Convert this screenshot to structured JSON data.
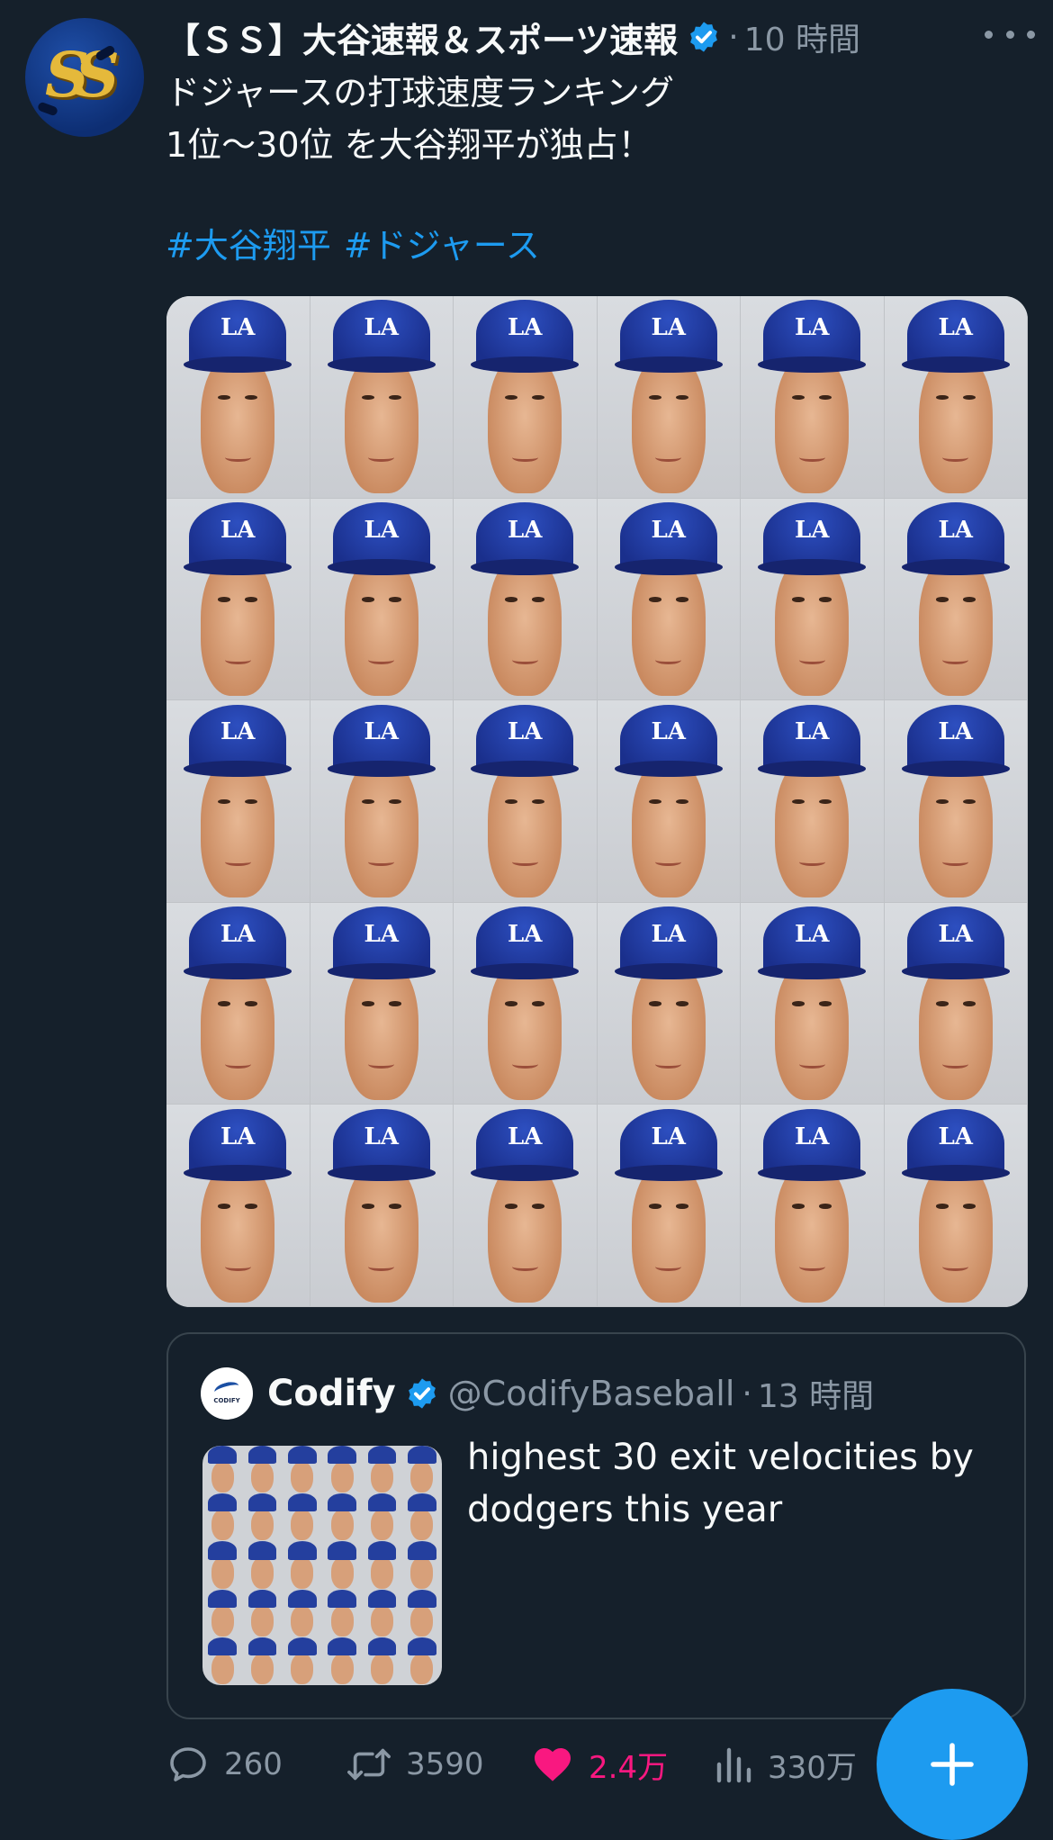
{
  "tweet": {
    "author_name": "【ＳＳ】大谷速報＆スポーツ速報",
    "time": "10 時間",
    "text_lines": [
      "ドジャースの打球速度ランキング",
      "1位〜30位 を大谷翔平が独占！"
    ],
    "hashtags": [
      "#大谷翔平",
      "#ドジャース"
    ],
    "avatar_text": "SS",
    "cap_logo": "LA"
  },
  "quote": {
    "author_name": "Codify",
    "handle": "@CodifyBaseball",
    "time": "13 時間",
    "text": "highest 30 exit velocities by dodgers this year",
    "avatar_text": "CODIFY"
  },
  "actions": {
    "reply_count": "260",
    "retweet_count": "3590",
    "like_count": "2.4万",
    "views_count": "330万"
  },
  "colors": {
    "background": "#15202b",
    "accent": "#1d9bf0",
    "like": "#f91880",
    "muted": "#8b98a5"
  },
  "icons": [
    "verified-badge-icon",
    "more-options-icon",
    "reply-icon",
    "retweet-icon",
    "like-icon",
    "views-icon",
    "compose-plus-icon"
  ]
}
